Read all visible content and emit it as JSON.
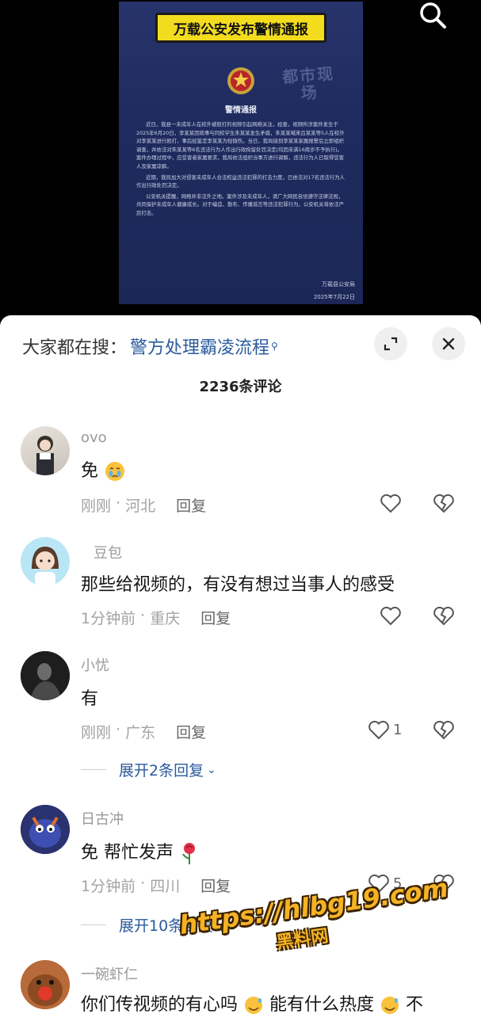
{
  "video": {
    "poster_title": "万载公安发布警情通报",
    "poster_watermark": "都市现场",
    "poster_subtitle": "警情通报",
    "poster_paragraphs": [
      "近日，我县一未成年人在校外被殴打的视频引起网络关注，经查，视频所涉案件发生于2025年6月20日，李某某因琐事与同校学生朱某某发生矛盾，朱某某喊来吕某某等5人在校外对李某某进行殴打，事后经鉴定李某某为轻微伤。当日，我局接到李某某家属报警后立即组织调查，并依法对朱某某等6名违法行为人作出行政拘留处罚决定(均因未满16周岁不予执行)。案件办理过程中，应受害者家属要求，我局依法组织当事方进行调解，违法行为人已取得受害人及家属谅解。",
      "近期，我局加大对侵害未成年人合法权益违法犯罪的打击力度，已依法对17名违法行为人作出行政处罚决定。",
      "公安机关提醒，网络并非法外之地。案件涉及未成年人，请广大网民自觉遵守法律法规，共同保护未成年人健康成长。对于编造、散布、传播谣言等违法犯罪行为，公安机关将依法严厉打击。"
    ],
    "poster_signature": "万载县公安局",
    "poster_date": "2025年7月22日"
  },
  "sheet": {
    "search_prefix": "大家都在搜：",
    "search_term": "警方处理霸凌流程",
    "comment_count": "2236条评论"
  },
  "comments": [
    {
      "user": "ovo",
      "text": "免",
      "time": "刚刚",
      "location": "河北",
      "reply": "回复",
      "likes": ""
    },
    {
      "user": "豆包",
      "text": "那些给视频的，有没有想过当事人的感受",
      "time": "1分钟前",
      "location": "重庆",
      "reply": "回复",
      "likes": ""
    },
    {
      "user": "小忧",
      "text": "有",
      "time": "刚刚",
      "location": "广东",
      "reply": "回复",
      "likes": "1",
      "expand": "展开2条回复"
    },
    {
      "user": "日古冲",
      "text": "免 帮忙发声",
      "time": "1分钟前",
      "location": "四川",
      "reply": "回复",
      "likes": "5",
      "expand": "展开10条回复"
    },
    {
      "user": "一碗虾仁",
      "text": "你们传视频的有心吗",
      "text_2": "能有什么热度",
      "text_3": "不"
    }
  ],
  "watermark": {
    "url": "https://hlbg19.com",
    "cn": "黑料网"
  },
  "icons": {
    "top_search": "search-icon",
    "expand": "expand-icon",
    "close": "close-icon",
    "like": "heart-icon",
    "dislike": "broken-heart-icon"
  },
  "colors": {
    "link_blue": "#2a5b9c",
    "poster_bg": "#27336b",
    "title_yellow": "#f3dc1e"
  }
}
